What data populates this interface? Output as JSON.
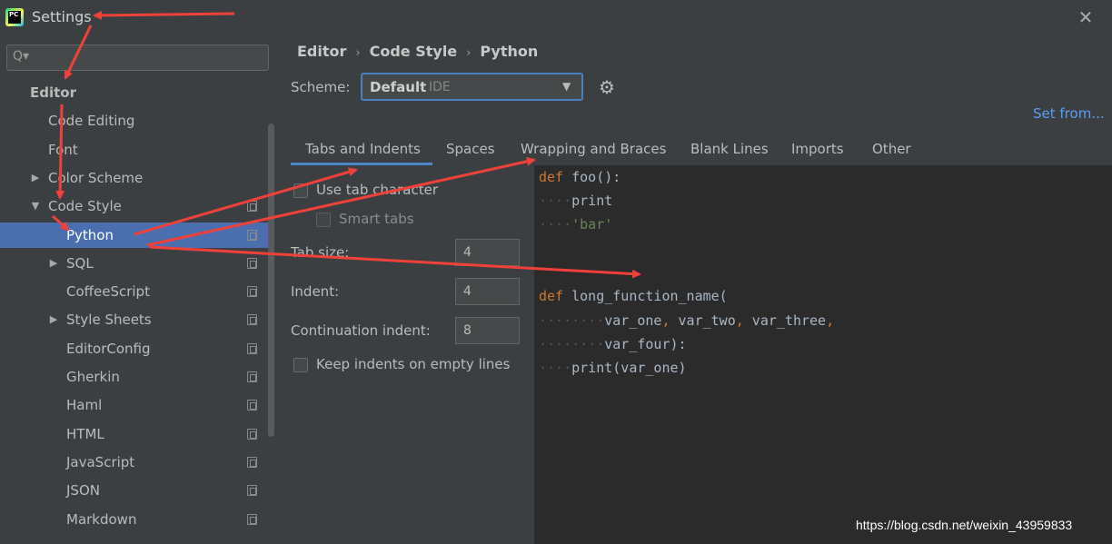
{
  "window": {
    "title": "Settings",
    "close_glyph": "✕",
    "app_icon_text": "PC"
  },
  "sidebar": {
    "search_placeholder": "",
    "search_icon": "Q▾",
    "items": [
      {
        "label": "Editor",
        "level": 0,
        "arrow": ""
      },
      {
        "label": "Code Editing",
        "level": 1,
        "arrow": ""
      },
      {
        "label": "Font",
        "level": 1,
        "arrow": ""
      },
      {
        "label": "Color Scheme",
        "level": 1,
        "arrow": "▶"
      },
      {
        "label": "Code Style",
        "level": 1,
        "arrow": "▼"
      },
      {
        "label": "Python",
        "level": 2,
        "arrow": ""
      },
      {
        "label": "SQL",
        "level": 2,
        "arrow": "▶"
      },
      {
        "label": "CoffeeScript",
        "level": 2,
        "arrow": ""
      },
      {
        "label": "Style Sheets",
        "level": 2,
        "arrow": "▶"
      },
      {
        "label": "EditorConfig",
        "level": 2,
        "arrow": ""
      },
      {
        "label": "Gherkin",
        "level": 2,
        "arrow": ""
      },
      {
        "label": "Haml",
        "level": 2,
        "arrow": ""
      },
      {
        "label": "HTML",
        "level": 2,
        "arrow": ""
      },
      {
        "label": "JavaScript",
        "level": 2,
        "arrow": ""
      },
      {
        "label": "JSON",
        "level": 2,
        "arrow": ""
      },
      {
        "label": "Markdown",
        "level": 2,
        "arrow": ""
      }
    ],
    "selected_item": "Python"
  },
  "breadcrumb": [
    "Editor",
    "Code Style",
    "Python"
  ],
  "breadcrumb_sep": "›",
  "scheme": {
    "label": "Scheme:",
    "value": "Default",
    "sub": "IDE",
    "caret": "▼",
    "gear_icon": "⚙",
    "set_from": "Set from..."
  },
  "tabs": [
    "Tabs and Indents",
    "Spaces",
    "Wrapping and Braces",
    "Blank Lines",
    "Imports",
    "Other"
  ],
  "active_tab": "Tabs and Indents",
  "options": {
    "use_tab_character": "Use tab character",
    "smart_tabs": "Smart tabs",
    "tab_size_label": "Tab size:",
    "tab_size": "4",
    "indent_label": "Indent:",
    "indent": "4",
    "continuation_label": "Continuation indent:",
    "continuation": "8",
    "keep_indents": "Keep indents on empty lines"
  },
  "code": {
    "l1_kw": "def",
    "l1_rest": " foo():",
    "l2_dots": "····",
    "l2_text": "print",
    "l3_dots": "····",
    "l3_str": "'bar'",
    "l4_kw": "def",
    "l4_rest": " long_function_name(",
    "l5_dots": "········",
    "l5_text": "var_one",
    "l5_c1": ",",
    "l5_text2": " var_two",
    "l5_c2": ",",
    "l5_text3": " var_three",
    "l5_c3": ",",
    "l6_dots": "········",
    "l6_text": "var_four):",
    "l7_dots": "····",
    "l7_text": "print(var_one)"
  },
  "watermark": "https://blog.csdn.net/weixin_43959833",
  "colors": {
    "background": "#3c3f41",
    "code_bg": "#2b2b2b",
    "selection": "#4b6eaf",
    "link": "#589df6",
    "keyword": "#cc7832",
    "string": "#6a8759",
    "annotation": "#f0403a"
  }
}
